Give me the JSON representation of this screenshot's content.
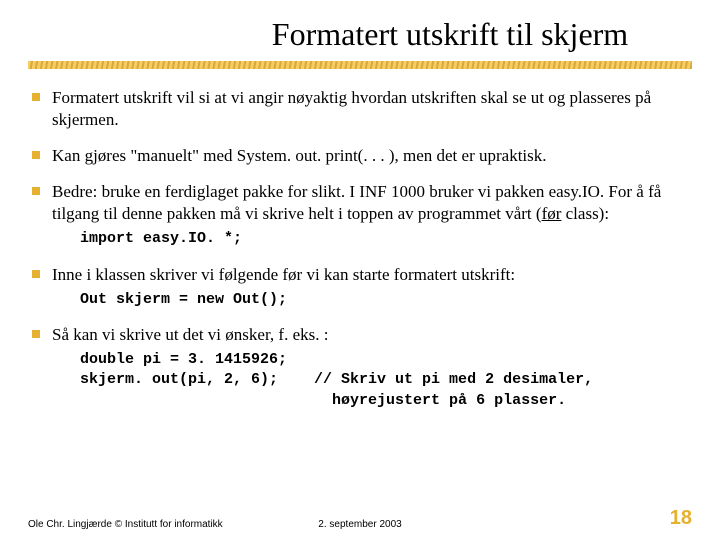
{
  "title": "Formatert utskrift til skjerm",
  "bullets": [
    {
      "text": "Formatert utskrift vil si at vi angir nøyaktig hvordan utskriften skal se ut og plasseres på skjermen."
    },
    {
      "text": "Kan gjøres \"manuelt\" med System. out. print(. . . ), men det er upraktisk."
    },
    {
      "text_pre": "Bedre: bruke en ferdiglaget pakke for slikt.   I INF 1000 bruker vi pakken easy.IO.  For å få tilgang til denne pakken må vi skrive helt i toppen av programmet vårt (",
      "underlined": "før",
      "text_post": " class):",
      "code": "import easy.IO. *;"
    },
    {
      "text": "Inne i klassen skriver vi følgende før vi kan starte formatert utskrift:",
      "code": "Out skjerm = new Out();"
    },
    {
      "text": "Så kan vi skrive ut det vi ønsker, f. eks. :",
      "code": "double pi = 3. 1415926;\nskjerm. out(pi, 2, 6);    // Skriv ut pi med 2 desimaler,\n                            høyrejustert på 6 plasser."
    }
  ],
  "footer": {
    "left": "Ole Chr. Lingjærde © Institutt for informatikk",
    "center": "2. september 2003",
    "right": "18"
  }
}
